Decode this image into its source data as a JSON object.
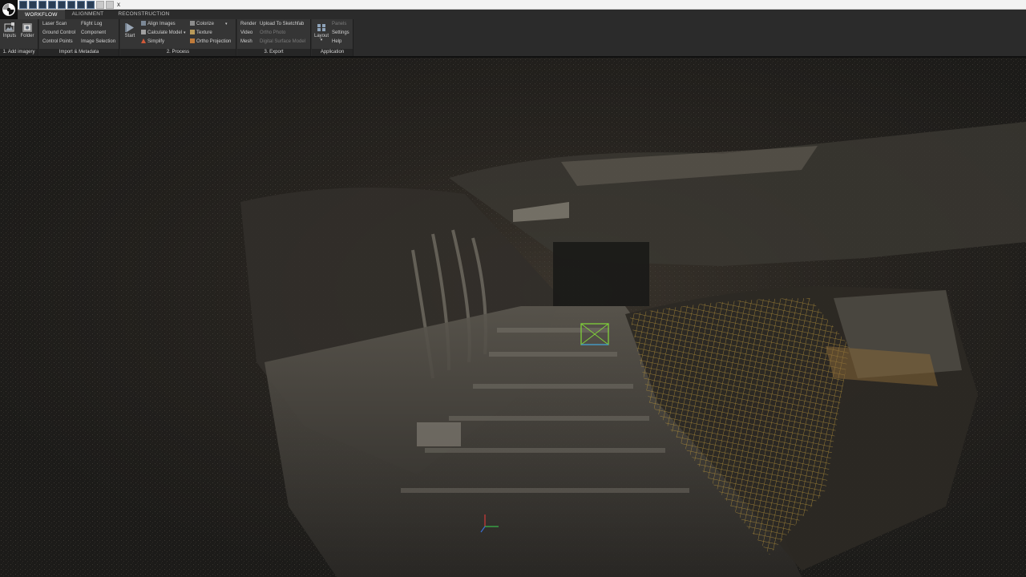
{
  "titlebar": {
    "title": "x"
  },
  "tabs": [
    {
      "label": "WORKFLOW"
    },
    {
      "label": "ALIGNMENT"
    },
    {
      "label": "RECONSTRUCTION"
    }
  ],
  "add_imagery": {
    "footer": "1. Add imagery",
    "inputs": "Inputs",
    "folder": "Folder"
  },
  "import_metadata": {
    "footer": "Import & Metadata",
    "laser_scan": "Laser Scan",
    "ground_control": "Ground Control",
    "control_points": "Control Points",
    "flight_log": "Flight Log",
    "component": "Component",
    "image_selection": "Image Selection"
  },
  "process": {
    "footer": "2. Process",
    "start": "Start",
    "align_images": "Align Images",
    "calculate_model": "Calculate Model",
    "simplify": "Simplify",
    "colorize": "Colorize",
    "texture": "Texture",
    "ortho_projection": "Ortho Projection"
  },
  "export": {
    "footer": "3. Export",
    "render": "Render",
    "video": "Video",
    "mesh": "Mesh",
    "upload_sketchfab": "Upload To Sketchfab",
    "ortho_photo": "Ortho Photo",
    "digital_surface_model": "Digital Surface Model"
  },
  "application": {
    "footer": "Application",
    "layout": "Layout",
    "panels": "Panels",
    "settings": "Settings",
    "help": "Help"
  },
  "colors": {
    "ribbon_bg": "#2b2b2b",
    "panel_bg": "#353535",
    "viewport_bg": "#1f1e1c",
    "camera_frustum": "#7fd03a",
    "camera_frustum_alt": "#3b8fd9",
    "net_color": "#b8943a"
  }
}
